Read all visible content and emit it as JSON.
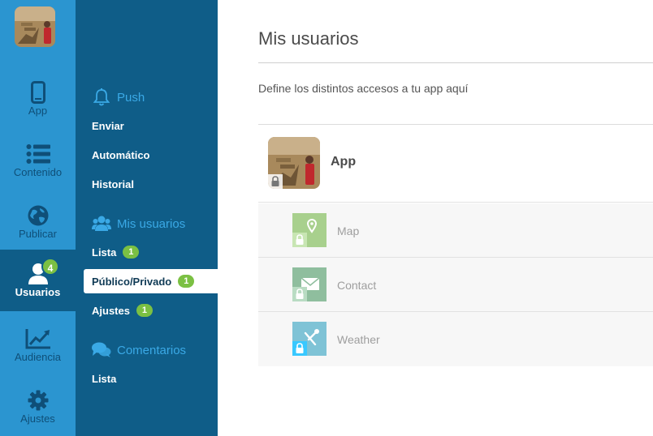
{
  "rail": {
    "items": [
      {
        "label": "App",
        "icon": "phone-icon"
      },
      {
        "label": "Contenido",
        "icon": "list-icon"
      },
      {
        "label": "Publicar",
        "icon": "globe-icon"
      },
      {
        "label": "Usuarios",
        "icon": "user-icon",
        "badge": "4",
        "active": true
      },
      {
        "label": "Audiencia",
        "icon": "chart-line-icon"
      },
      {
        "label": "Ajustes",
        "icon": "gear-icon"
      }
    ]
  },
  "sidebar": {
    "push": {
      "title": "Push",
      "icon": "bell-icon",
      "links": [
        {
          "label": "Enviar"
        },
        {
          "label": "Automático"
        },
        {
          "label": "Historial"
        }
      ]
    },
    "usuarios": {
      "title": "Mis usuarios",
      "icon": "users-icon",
      "links": [
        {
          "label": "Lista",
          "badge": "1"
        },
        {
          "label": "Público/Privado",
          "badge": "1",
          "active": true
        },
        {
          "label": "Ajustes",
          "badge": "1"
        }
      ]
    },
    "comentarios": {
      "title": "Comentarios",
      "icon": "comments-icon",
      "links": [
        {
          "label": "Lista"
        }
      ]
    }
  },
  "main": {
    "title": "Mis usuarios",
    "subtitle": "Define los distintos accesos a tu app aquí",
    "app": {
      "name": "App"
    },
    "sections": [
      {
        "name": "Map",
        "icon": "map-pin-icon",
        "color": "#a8d08d"
      },
      {
        "name": "Contact",
        "icon": "envelope-icon",
        "color": "#8fbe9e"
      },
      {
        "name": "Weather",
        "icon": "tools-icon",
        "color": "#7fc3d6"
      }
    ]
  },
  "colors": {
    "rail_bg": "#2b95d0",
    "sidebar_bg": "#0f5d88",
    "accent": "#3aa9e6",
    "badge": "#7bc043"
  }
}
